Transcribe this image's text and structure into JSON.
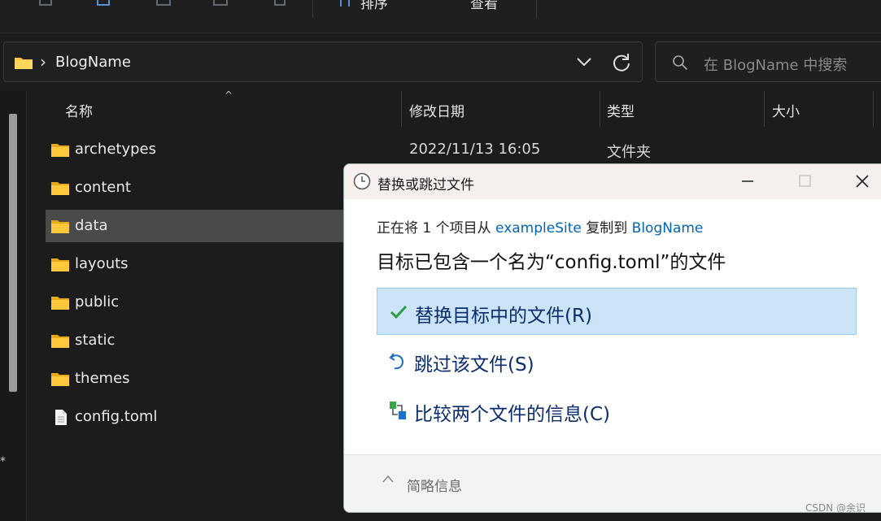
{
  "toolbar": {
    "sort_label": "排序",
    "view_label": "查看",
    "more_label": "•••"
  },
  "address": {
    "path_current": "BlogName"
  },
  "search": {
    "placeholder": "在 BlogName 中搜索"
  },
  "columns": {
    "name": "名称",
    "modified": "修改日期",
    "type": "类型",
    "size": "大小"
  },
  "files": [
    {
      "name": "archetypes",
      "date": "2022/11/13 16:05",
      "type": "文件夹",
      "kind": "folder"
    },
    {
      "name": "content",
      "kind": "folder"
    },
    {
      "name": "data",
      "kind": "folder",
      "selected": true
    },
    {
      "name": "layouts",
      "kind": "folder"
    },
    {
      "name": "public",
      "kind": "folder"
    },
    {
      "name": "static",
      "kind": "folder"
    },
    {
      "name": "themes",
      "kind": "folder"
    },
    {
      "name": "config.toml",
      "kind": "file"
    }
  ],
  "dialog": {
    "title": "替换或跳过文件",
    "info_prefix": "正在将 1 个项目从 ",
    "info_source": "exampleSite",
    "info_middle": " 复制到 ",
    "info_dest": "BlogName",
    "headline": "目标已包含一个名为“config.toml”的文件",
    "options": [
      {
        "label": "替换目标中的文件(R)",
        "icon": "check-icon"
      },
      {
        "label": "跳过该文件(S)",
        "icon": "undo-icon"
      },
      {
        "label": "比较两个文件的信息(C)",
        "icon": "compare-icon"
      }
    ],
    "footer": "简略信息"
  },
  "watermark": "CSDN @余识",
  "colors": {
    "accent_link": "#0066b4",
    "highlight": "#cce4f7",
    "folder": "#f6c343"
  }
}
